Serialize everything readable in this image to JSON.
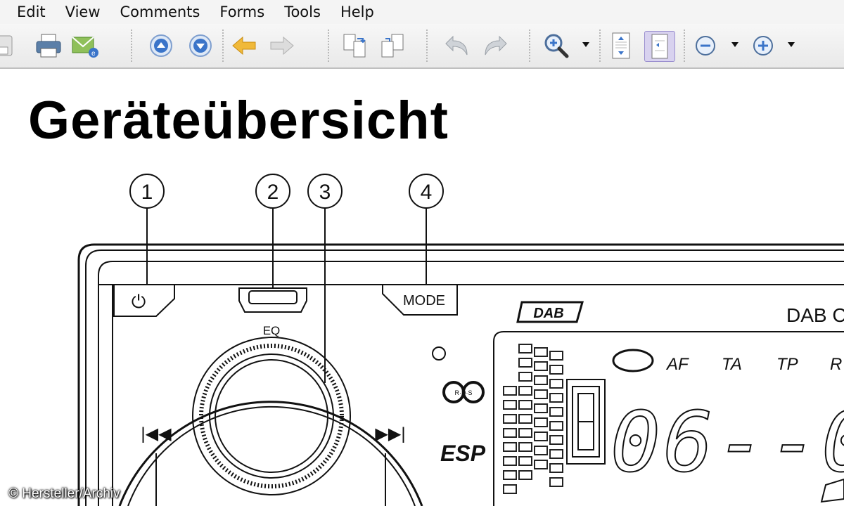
{
  "menu": [
    "Edit",
    "View",
    "Comments",
    "Forms",
    "Tools",
    "Help"
  ],
  "toolbar": {
    "icons": [
      "save-icon",
      "print-icon",
      "email-icon",
      "page-up-icon",
      "page-down-icon",
      "back-icon",
      "forward-icon",
      "extract-pages-icon",
      "insert-pages-icon",
      "undo-icon",
      "redo-icon",
      "zoom-icon",
      "fit-page-icon",
      "fit-width-icon",
      "zoom-out-icon",
      "zoom-in-icon"
    ]
  },
  "document": {
    "title": "Geräteübersicht",
    "callouts": [
      "1",
      "2",
      "3",
      "4"
    ],
    "device": {
      "mode_label": "MODE",
      "eq_label": "EQ",
      "dab_logo": "DAB",
      "model_text": "DAB C",
      "esp_label": "ESP",
      "rds_label": "R·D·S",
      "indicators": [
        "AF",
        "TA",
        "TP",
        "R"
      ],
      "display_text": "06--0",
      "prev_symbol": "|◀◀",
      "next_symbol": "▶▶|",
      "power_symbol": "⏻"
    },
    "credit": "© Hersteller/Archiv"
  },
  "colors": {
    "toolbar_blue": "#3a74c9",
    "toolbar_arrow": "#f0b93a",
    "email_green": "#6cae3c"
  }
}
